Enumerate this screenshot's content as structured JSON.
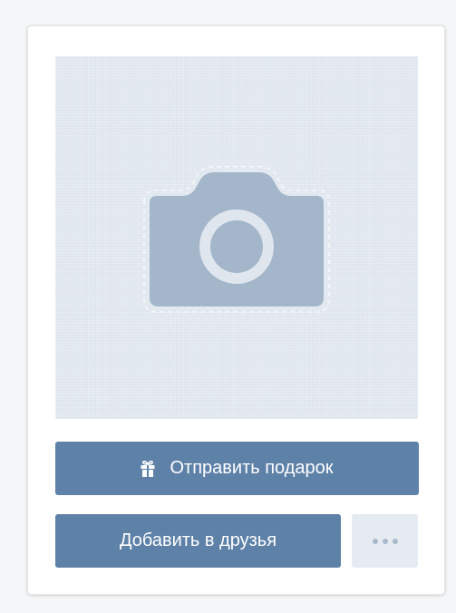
{
  "profile_card": {
    "photo": {
      "icon": "camera-icon",
      "background_color": "#dfe6ee",
      "icon_color": "#a4b6ca"
    },
    "gift_button": {
      "label": "Отправить подарок",
      "icon": "gift-icon"
    },
    "add_friend_button": {
      "label": "Добавить в друзья"
    },
    "more_button": {
      "icon": "more-dots-icon"
    }
  },
  "colors": {
    "primary_button": "#5e81a8",
    "secondary_button": "#e5ebf1",
    "card_background": "#ffffff"
  }
}
